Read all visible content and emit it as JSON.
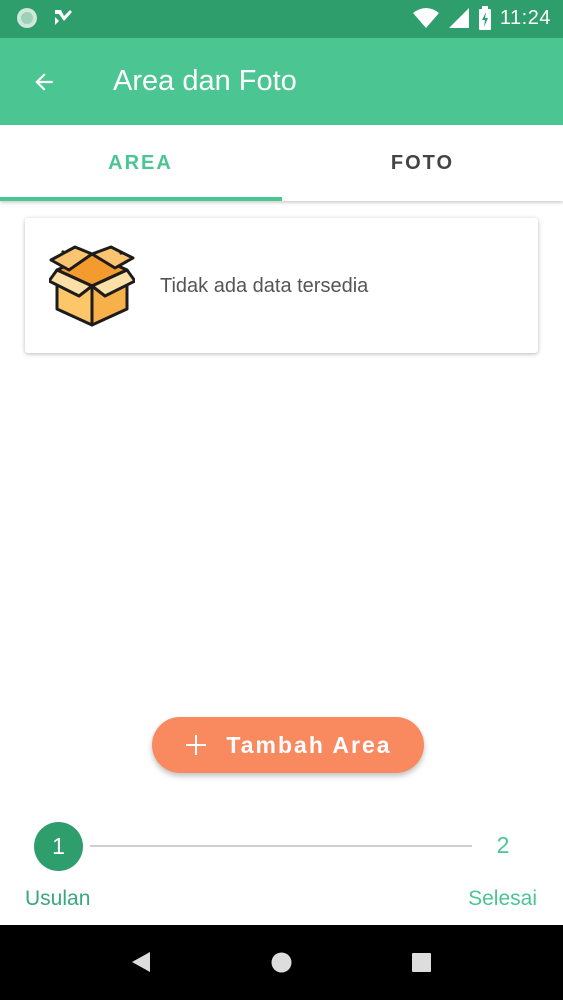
{
  "status_bar": {
    "time": "11:24",
    "icons": [
      "app-notification-icon",
      "check-notification-icon",
      "wifi-icon",
      "signal-icon",
      "battery-charging-icon"
    ]
  },
  "app_bar": {
    "title": "Area dan Foto",
    "back_icon": "arrow-back-icon"
  },
  "tabs": [
    {
      "label": "AREA",
      "active": true
    },
    {
      "label": "FOTO",
      "active": false
    }
  ],
  "empty_state": {
    "icon": "open-box-icon",
    "message": "Tidak ada data tersedia"
  },
  "fab": {
    "icon": "plus-icon",
    "label": "Tambah Area"
  },
  "stepper": {
    "steps": [
      {
        "number": "1",
        "label": "Usulan",
        "active": true
      },
      {
        "number": "2",
        "label": "Selesai",
        "active": false
      }
    ]
  },
  "nav_bar": {
    "icons": [
      "back-triangle-icon",
      "home-circle-icon",
      "recents-square-icon"
    ]
  },
  "colors": {
    "status_bar": "#2e9e6c",
    "primary": "#4bc592",
    "accent": "#f98a60",
    "step_active": "#2e9e6c"
  }
}
